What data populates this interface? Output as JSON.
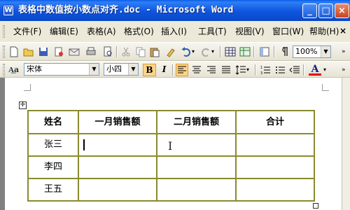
{
  "window": {
    "title": "表格中数值按小数点对齐.doc - Microsoft Word",
    "buttons": {
      "minimize": "_",
      "maximize": "□",
      "close": "×"
    }
  },
  "menubar": {
    "items": [
      "文件(F)",
      "编辑(E)",
      "表格(A)",
      "格式(O)",
      "插入(I)",
      "工具(T)",
      "视图(V)",
      "窗口(W)",
      "帮助(H)"
    ],
    "close": "×"
  },
  "toolbar": {
    "zoom": "100%",
    "font_style_badge": "A͟a",
    "font_name": "宋体",
    "font_size": "小四",
    "bold": "B",
    "italic": "I",
    "font_color_label": "A"
  },
  "table": {
    "headers": [
      "姓名",
      "一月销售额",
      "二月销售额",
      "合计"
    ],
    "rows": [
      [
        "张三",
        "",
        "",
        ""
      ],
      [
        "李四",
        "",
        "",
        ""
      ],
      [
        "王五",
        "",
        "",
        ""
      ]
    ]
  },
  "colors": {
    "title_bar": "#0a55de",
    "table_border": "#8a8a2f",
    "active_button": "#fbd48a"
  }
}
